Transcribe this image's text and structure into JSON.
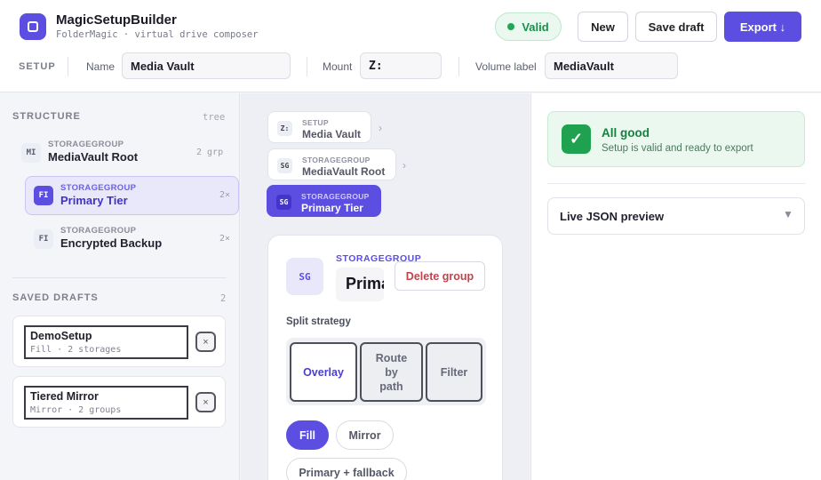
{
  "app": {
    "title": "MagicSetupBuilder",
    "subtitle": "FolderMagic · virtual drive composer"
  },
  "header": {
    "valid_label": "Valid",
    "new_label": "New",
    "save_label": "Save draft",
    "export_label": "Export ↓"
  },
  "setup": {
    "section_label": "SETUP",
    "name_label": "Name",
    "name_value": "Media Vault",
    "mount_label": "Mount",
    "mount_value": "Z:",
    "volume_label": "Volume label",
    "volume_value": "MediaVault"
  },
  "structure": {
    "title": "STRUCTURE",
    "hint": "tree",
    "items": [
      {
        "icon": "MI",
        "kind": "STORAGEGROUP",
        "name": "MediaVault Root",
        "meta": "2 grp"
      },
      {
        "icon": "FI",
        "kind": "STORAGEGROUP",
        "name": "Primary Tier",
        "meta": "2×"
      },
      {
        "icon": "FI",
        "kind": "STORAGEGROUP",
        "name": "Encrypted Backup",
        "meta": "2×"
      }
    ]
  },
  "drafts": {
    "title": "SAVED DRAFTS",
    "count": "2",
    "items": [
      {
        "name": "DemoSetup",
        "sub": "Fill · 2 storages",
        "remove": "×"
      },
      {
        "name": "Tiered Mirror",
        "sub": "Mirror · 2 groups",
        "remove": "×"
      }
    ]
  },
  "breadcrumbs": [
    {
      "icon": "Z:",
      "kind": "SETUP",
      "name": "Media Vault",
      "chevron": "›"
    },
    {
      "icon": "SG",
      "kind": "STORAGEGROUP",
      "name": "MediaVault Root",
      "chevron": "›"
    },
    {
      "icon": "SG",
      "kind": "STORAGEGROUP",
      "name": "Primary Tier"
    }
  ],
  "editor": {
    "icon": "SG",
    "kind": "STORAGEGROUP",
    "name_value": "Primary Tier",
    "delete_label": "Delete group",
    "strategy_label": "Split strategy",
    "strategies": [
      "Overlay",
      "Route by path",
      "Filter"
    ],
    "modes": [
      "Fill",
      "Mirror",
      "Primary + fallback"
    ]
  },
  "status": {
    "title": "All good",
    "subtitle": "Setup is valid and ready to export",
    "check": "✓"
  },
  "json_preview": {
    "title": "Live JSON preview",
    "caret": "▼"
  },
  "colors": {
    "accent": "#5b4ee0",
    "success": "#1ea24f",
    "danger": "#c2434e"
  }
}
